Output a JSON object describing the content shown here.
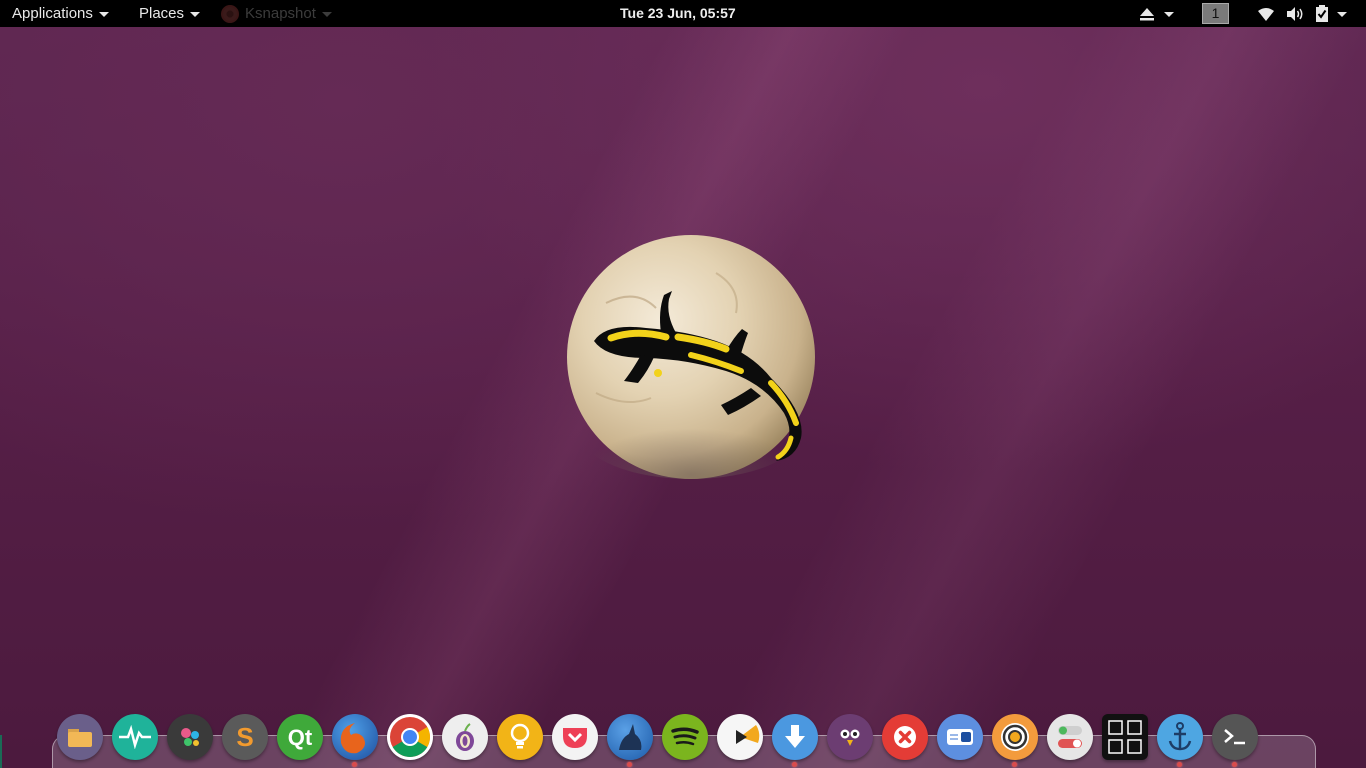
{
  "top_panel": {
    "applications_label": "Applications",
    "places_label": "Places",
    "active_app_label": "Ksnapshot",
    "clock": "Tue 23 Jun, 05:57",
    "workspace_number": "1",
    "tray_icons": [
      "eject-icon",
      "chevron-down-icon",
      "workspace-indicator",
      "wifi-icon",
      "volume-icon",
      "battery-icon",
      "power-caret-icon"
    ]
  },
  "desktop": {
    "wallpaper_colors": {
      "base": "#561f47",
      "highlight": "#6e2f5c"
    },
    "logo": "salamander-on-stone"
  },
  "dock": {
    "icons": [
      {
        "name": "files-icon",
        "color": "#6a5f8a"
      },
      {
        "name": "system-monitor-icon",
        "color": "#1fb39a"
      },
      {
        "name": "settings-gears-icon",
        "color": "#3a3a3a"
      },
      {
        "name": "sublime-text-icon",
        "color": "#5a5a5a"
      },
      {
        "name": "qt-creator-icon",
        "color": "#3fa93a"
      },
      {
        "name": "firefox-icon",
        "color": "#2a62b8"
      },
      {
        "name": "chrome-icon",
        "color": "#ffffff"
      },
      {
        "name": "tor-browser-icon",
        "color": "#eeeeee"
      },
      {
        "name": "idea-bulb-icon",
        "color": "#f2b417"
      },
      {
        "name": "pocket-icon",
        "color": "#f3f3f3"
      },
      {
        "name": "howl-wolf-icon",
        "color": "#2d6fbf"
      },
      {
        "name": "spotify-icon",
        "color": "#7bb51e"
      },
      {
        "name": "media-player-icon",
        "color": "#f6f6f6"
      },
      {
        "name": "download-icon",
        "color": "#4b98e0"
      },
      {
        "name": "bird-client-icon",
        "color": "#6c3d72"
      },
      {
        "name": "close-x-icon",
        "color": "#e43c36"
      },
      {
        "name": "toggle-app-icon",
        "color": "#5d8fe0"
      },
      {
        "name": "record-icon",
        "color": "#f39b3d"
      },
      {
        "name": "switches-icon",
        "color": "#e6e6e6"
      },
      {
        "name": "workspaces-grid-icon",
        "color": "#111111"
      },
      {
        "name": "anchor-icon",
        "color": "#4ea6e2"
      },
      {
        "name": "terminal-icon",
        "color": "#555555"
      }
    ],
    "running_indicators": [
      "firefox-icon",
      "howl-wolf-icon",
      "download-icon",
      "record-icon",
      "anchor-icon",
      "terminal-icon"
    ]
  }
}
